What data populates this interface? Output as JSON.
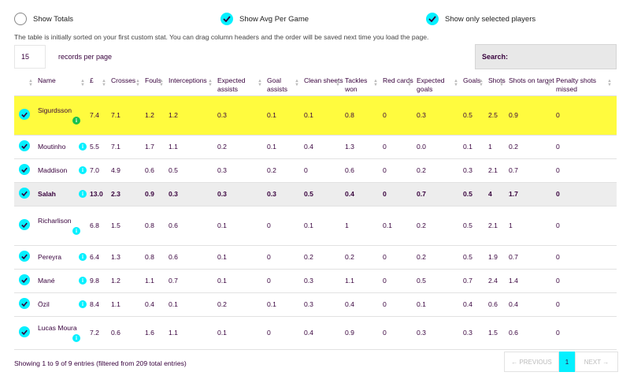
{
  "toggles": {
    "show_totals": "Show Totals",
    "show_avg": "Show Avg Per Game",
    "show_selected": "Show only selected players"
  },
  "note": "The table is initially sorted on your first custom stat. You can drag column headers and the order will be saved next time you load the page.",
  "per_page": {
    "value": "15",
    "label": "records per page"
  },
  "search": {
    "label": "Search:"
  },
  "columns": [
    "Name",
    "£",
    "Crosses",
    "Fouls",
    "Interceptions",
    "Expected assists",
    "Goal assists",
    "Clean sheets",
    "Tackles won",
    "Red cards",
    "Expected goals",
    "Goals",
    "Shots",
    "Shots on target",
    "Penalty shots missed"
  ],
  "rows": [
    {
      "name": "Sigurdsson",
      "values": [
        "7.4",
        "7.1",
        "1.2",
        "1.2",
        "0.3",
        "0.1",
        "0.1",
        "0.8",
        "0",
        "0.3",
        "0.5",
        "2.5",
        "0.9",
        "0"
      ]
    },
    {
      "name": "Moutinho",
      "values": [
        "5.5",
        "7.1",
        "1.7",
        "1.1",
        "0.2",
        "0.1",
        "0.4",
        "1.3",
        "0",
        "0.0",
        "0.1",
        "1",
        "0.2",
        "0"
      ]
    },
    {
      "name": "Maddison",
      "values": [
        "7.0",
        "4.9",
        "0.6",
        "0.5",
        "0.3",
        "0.2",
        "0",
        "0.6",
        "0",
        "0.2",
        "0.3",
        "2.1",
        "0.7",
        "0"
      ]
    },
    {
      "name": "Salah",
      "values": [
        "13.0",
        "2.3",
        "0.9",
        "0.3",
        "0.3",
        "0.3",
        "0.5",
        "0.4",
        "0",
        "0.7",
        "0.5",
        "4",
        "1.7",
        "0"
      ]
    },
    {
      "name": "Richarlison",
      "values": [
        "6.8",
        "1.5",
        "0.8",
        "0.6",
        "0.1",
        "0",
        "0.1",
        "1",
        "0.1",
        "0.2",
        "0.5",
        "2.1",
        "1",
        "0"
      ]
    },
    {
      "name": "Pereyra",
      "values": [
        "6.4",
        "1.3",
        "0.8",
        "0.6",
        "0.1",
        "0",
        "0.2",
        "0.2",
        "0",
        "0.2",
        "0.5",
        "1.9",
        "0.7",
        "0"
      ]
    },
    {
      "name": "Mané",
      "values": [
        "9.8",
        "1.2",
        "1.1",
        "0.7",
        "0.1",
        "0",
        "0.3",
        "1.1",
        "0",
        "0.5",
        "0.7",
        "2.4",
        "1.4",
        "0"
      ]
    },
    {
      "name": "Özil",
      "values": [
        "8.4",
        "1.1",
        "0.4",
        "0.1",
        "0.2",
        "0.1",
        "0.3",
        "0.4",
        "0",
        "0.1",
        "0.4",
        "0.6",
        "0.4",
        "0"
      ]
    },
    {
      "name": "Lucas Moura",
      "values": [
        "7.2",
        "0.6",
        "1.6",
        "1.1",
        "0.1",
        "0",
        "0.4",
        "0.9",
        "0",
        "0.3",
        "0.3",
        "1.5",
        "0.6",
        "0"
      ]
    }
  ],
  "info_glyph": "i",
  "footer": "Showing 1 to 9 of 9 entries (filtered from 209 total entries)",
  "pager": {
    "prev": "← PREVIOUS",
    "current": "1",
    "next": "NEXT →"
  },
  "colors": {
    "accent": "#05f0ff",
    "highlight": "#fffb3e",
    "text": "#37003c",
    "info_green": "#18c14e"
  }
}
